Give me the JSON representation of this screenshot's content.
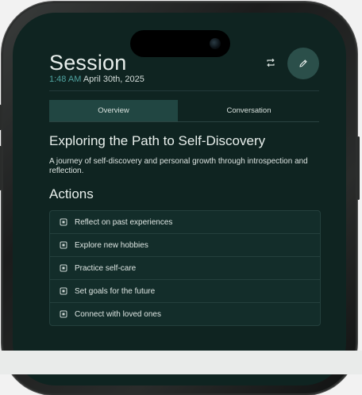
{
  "header": {
    "title": "Session",
    "time": "1:48 AM",
    "date": "April 30th, 2025"
  },
  "icons": {
    "repeat": "repeat-icon",
    "edit": "pencil-icon",
    "action": "checkbox-icon"
  },
  "tabs": [
    {
      "label": "Overview",
      "active": true
    },
    {
      "label": "Conversation",
      "active": false
    }
  ],
  "overview": {
    "heading": "Exploring the Path to Self-Discovery",
    "description": "A journey of self-discovery and personal growth through introspection and reflection."
  },
  "actions": {
    "title": "Actions",
    "items": [
      {
        "label": "Reflect on past experiences"
      },
      {
        "label": "Explore new hobbies"
      },
      {
        "label": "Practice self-care"
      },
      {
        "label": "Set goals for the future"
      },
      {
        "label": "Connect with loved ones"
      }
    ]
  },
  "colors": {
    "background": "#0f2421",
    "accent": "#4fa3a0",
    "active_tab": "#214642",
    "edit_button": "#2b4f4a"
  }
}
